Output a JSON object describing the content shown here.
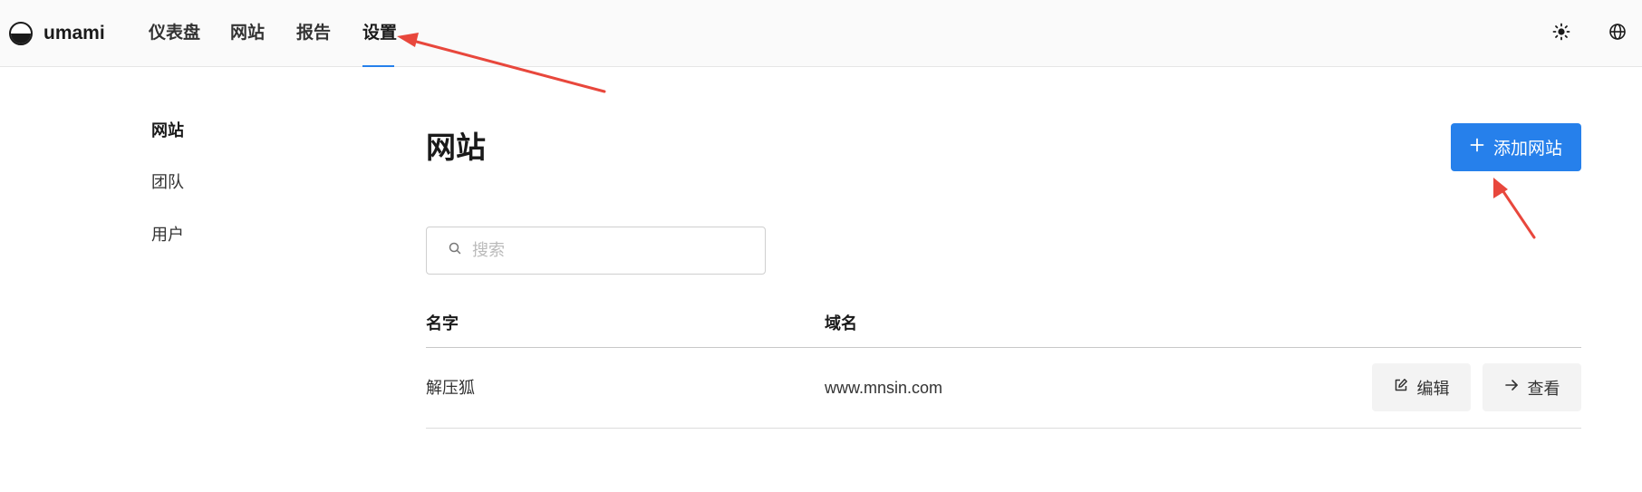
{
  "app": {
    "brand": "umami"
  },
  "nav": {
    "items": [
      {
        "label": "仪表盘"
      },
      {
        "label": "网站"
      },
      {
        "label": "报告"
      },
      {
        "label": "设置",
        "active": true
      }
    ]
  },
  "header_icons": {
    "theme": "sun-icon",
    "language": "globe-icon"
  },
  "sidebar": {
    "items": [
      {
        "label": "网站",
        "active": true
      },
      {
        "label": "团队"
      },
      {
        "label": "用户"
      }
    ]
  },
  "main": {
    "title": "网站",
    "add_button_label": "添加网站",
    "search_placeholder": "搜索",
    "columns": {
      "name": "名字",
      "domain": "域名"
    },
    "rows": [
      {
        "name": "解压狐",
        "domain": "www.mnsin.com",
        "edit_label": "编辑",
        "view_label": "查看"
      }
    ]
  },
  "colors": {
    "accent": "#2680eb",
    "annotation_arrow": "#e8473c"
  }
}
